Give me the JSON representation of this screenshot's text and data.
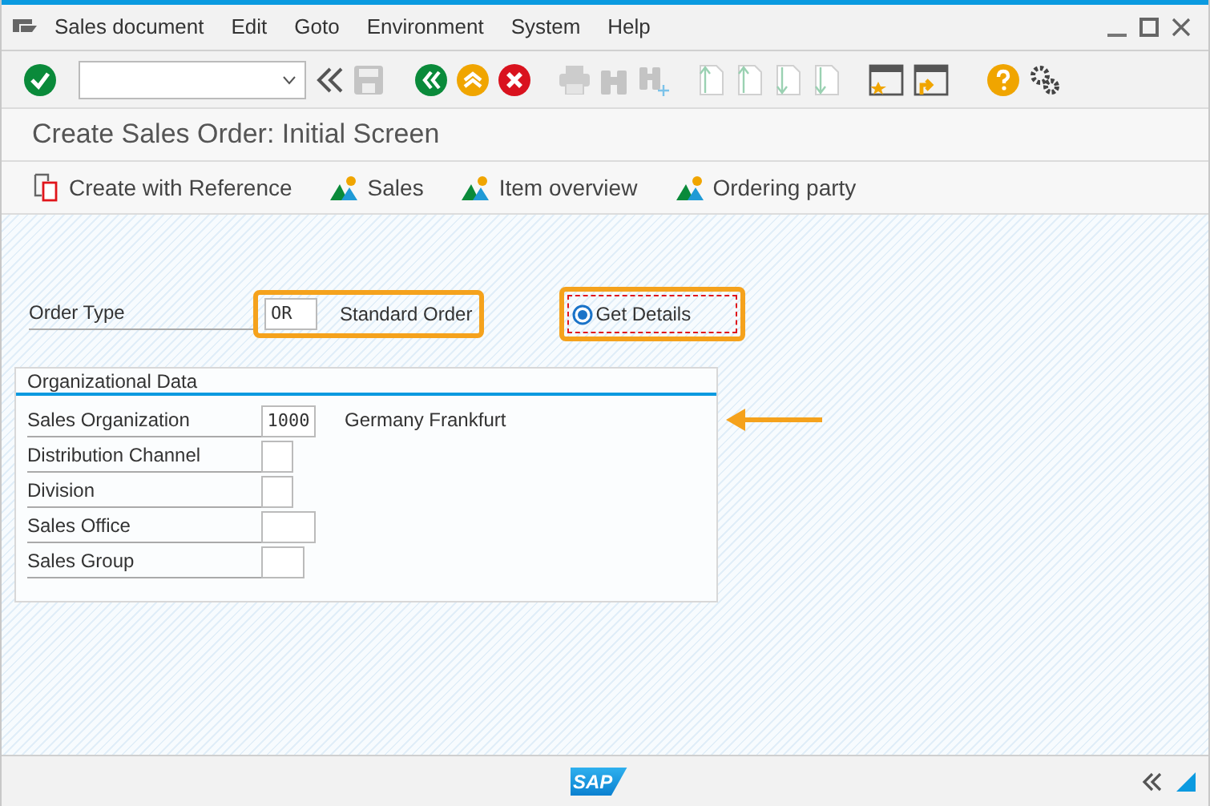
{
  "menu_bar": {
    "items": [
      "Sales document",
      "Edit",
      "Goto",
      "Environment",
      "System",
      "Help"
    ]
  },
  "title": "Create Sales Order: Initial Screen",
  "app_toolbar": [
    {
      "kind": "reference",
      "label": "Create with Reference"
    },
    {
      "kind": "people",
      "label": "Sales"
    },
    {
      "kind": "people",
      "label": "Item overview"
    },
    {
      "kind": "people",
      "label": "Ordering party"
    }
  ],
  "order_type": {
    "label": "Order Type",
    "value": "OR",
    "description": "Standard Order",
    "highlighted": true
  },
  "get_details": {
    "label": "Get Details",
    "selected": true,
    "highlighted": true
  },
  "organizational_data": {
    "title": "Organizational Data",
    "fields": [
      {
        "label": "Sales Organization",
        "value": "1000",
        "description": "Germany Frankfurt"
      },
      {
        "label": "Distribution Channel"
      },
      {
        "label": "Division"
      },
      {
        "label": "Sales Office"
      },
      {
        "label": "Sales Group"
      }
    ]
  },
  "status_bar": {
    "logo": "SAP"
  }
}
